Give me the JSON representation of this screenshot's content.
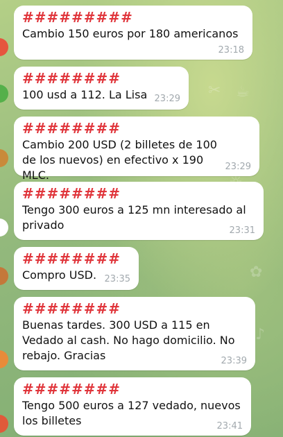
{
  "chat": {
    "messages": [
      {
        "sender": "#########",
        "text": "Cambio 150 euros por 180 americanos",
        "time": "23:18"
      },
      {
        "sender": "########",
        "text": "100 usd a 112. La Lisa",
        "time": "23:29"
      },
      {
        "sender": "########",
        "text": "Cambio 200 USD (2 billetes de 100 de los nuevos) en efectivo x 190 MLC.",
        "time": "23:29"
      },
      {
        "sender": "########",
        "text": "Tengo 300 euros a 125 mn interesado al privado",
        "time": "23:31"
      },
      {
        "sender": "########",
        "text": "Compro USD.",
        "time": "23:35"
      },
      {
        "sender": "########",
        "text": "Buenas tardes. 300 USD a 115 en Vedado al cash. No hago domicilio. No rebajo. Gracias",
        "time": "23:39"
      },
      {
        "sender": "########",
        "text": "Tengo 500 euros a 127 vedado, nuevos los billetes",
        "time": "23:41"
      }
    ]
  },
  "colors": {
    "sender_name": "#e0353b",
    "bubble": "#ffffff",
    "timestamp": "#a2a9ae",
    "wallpaper": "#8fb47a"
  },
  "icons": [
    "sender-avatar"
  ]
}
